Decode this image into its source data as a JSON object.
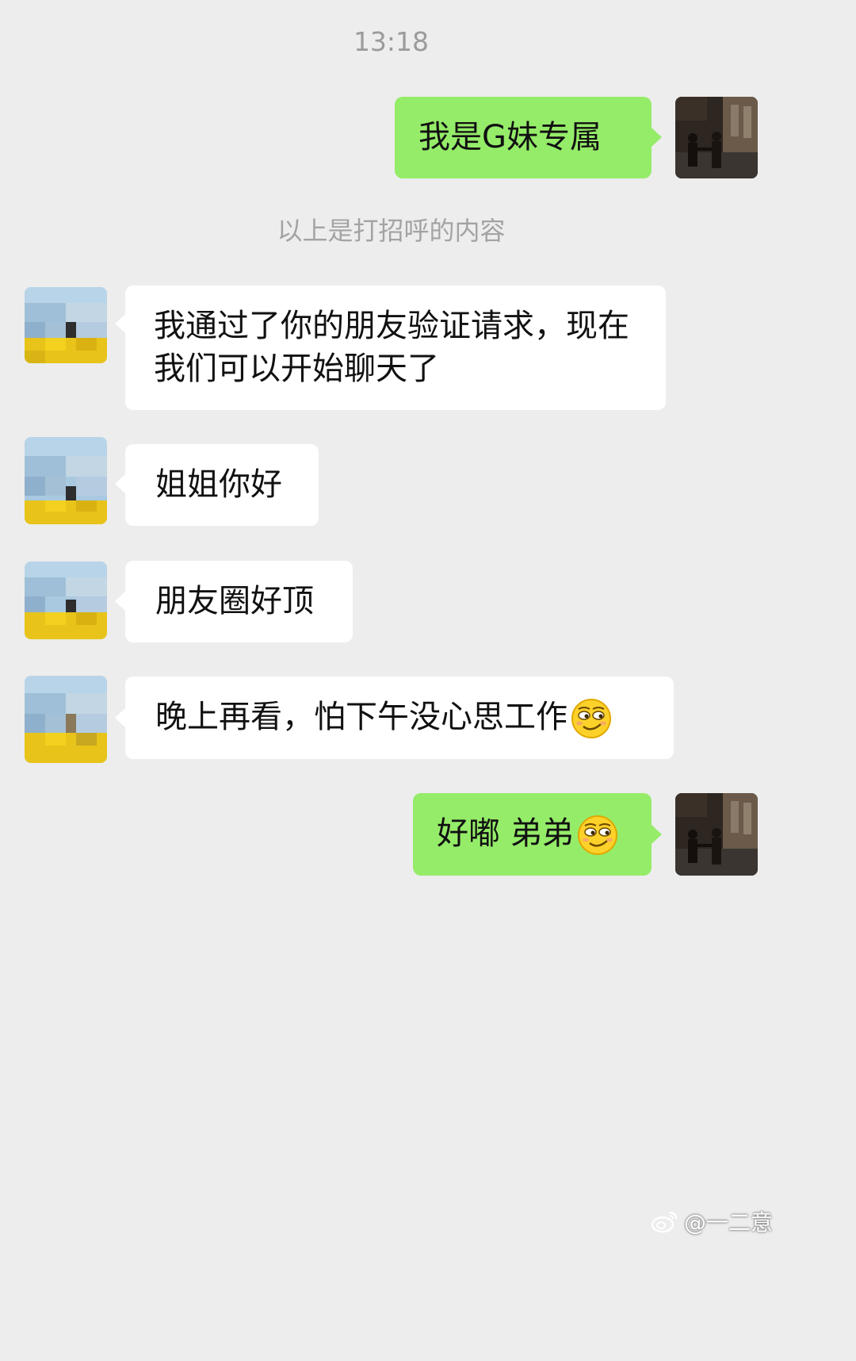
{
  "timestamp": "13:18",
  "system_notice": "以上是打招呼的内容",
  "messages": [
    {
      "side": "right",
      "text": "我是G妹专属"
    },
    {
      "side": "left",
      "text": "我通过了你的朋友验证请求，现在我们可以开始聊天了"
    },
    {
      "side": "left",
      "text": "姐姐你好"
    },
    {
      "side": "left",
      "text": "朋友圈好顶"
    },
    {
      "side": "left",
      "text": "晚上再看，怕下午没心思工作",
      "emoji": "smirk-emoji"
    },
    {
      "side": "right",
      "text": "好嘟 弟弟",
      "emoji": "smirk-emoji"
    }
  ],
  "watermark": {
    "text": "@一二意",
    "icon": "weibo-logo"
  },
  "colors": {
    "background": "#ededed",
    "outgoing_bubble": "#95ec69",
    "incoming_bubble": "#ffffff"
  }
}
